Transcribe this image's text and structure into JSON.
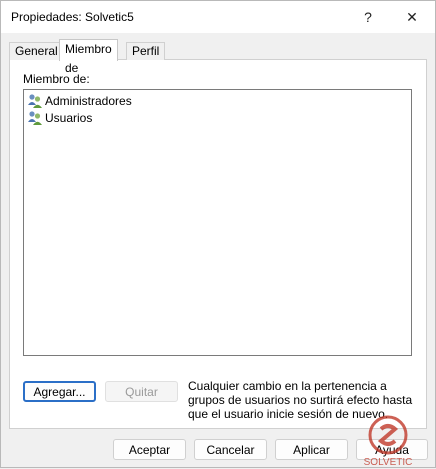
{
  "window": {
    "title": "Propiedades: Solvetic5",
    "help_label": "?",
    "close_label": "✕"
  },
  "tabs": [
    {
      "label": "General"
    },
    {
      "label": "Miembro de"
    },
    {
      "label": "Perfil"
    }
  ],
  "member_of": {
    "label": "Miembro de:",
    "items": [
      {
        "label": "Administradores",
        "icon": "group-icon"
      },
      {
        "label": "Usuarios",
        "icon": "group-icon"
      }
    ]
  },
  "actions": {
    "add_label": "Agregar...",
    "remove_label": "Quitar",
    "note": "Cualquier cambio en la pertenencia a grupos de usuarios no surtirá efecto hasta que el usuario inicie sesión de nuevo."
  },
  "footer": {
    "ok_label": "Aceptar",
    "cancel_label": "Cancelar",
    "apply_label": "Aplicar",
    "help_label": "Ayuda"
  },
  "watermark": {
    "text": "SOLVETIC",
    "color": "#c0392b"
  },
  "colors": {
    "accent": "#2b6fc7",
    "window_bg": "#f0f0f0"
  }
}
